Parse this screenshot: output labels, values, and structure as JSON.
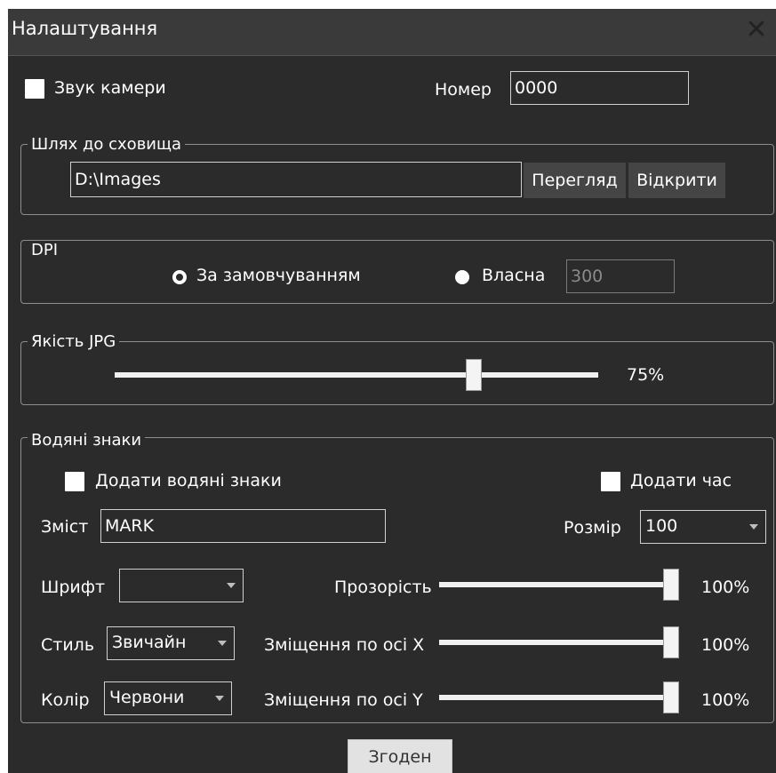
{
  "window": {
    "title": "Налаштування",
    "close_glyph": "✕"
  },
  "camera": {
    "sound_label": "Звук камери",
    "sound_checked": false,
    "number_label": "Номер",
    "number_value": "0000"
  },
  "storage": {
    "legend": "Шлях до сховища",
    "path_value": "D:\\Images",
    "browse_label": "Перегляд",
    "open_label": "Відкрити"
  },
  "dpi": {
    "legend": "DPI",
    "default_label": "За замовчуванням",
    "custom_label": "Власна",
    "custom_value": "300",
    "selected": "default"
  },
  "jpg": {
    "legend": "Якість JPG",
    "quality_label": "75%",
    "quality": 0.75
  },
  "watermark": {
    "legend": "Водяні знаки",
    "add_label": "Додати водяні знаки",
    "add_checked": false,
    "add_time_label": "Додати час",
    "add_time_checked": false,
    "content_label": "Зміст",
    "content_value": "MARK",
    "size_label": "Розмір",
    "size_value": "100",
    "font_label": "Шрифт",
    "font_value": "",
    "style_label": "Стиль",
    "style_value": "Звичайн",
    "color_label": "Колір",
    "color_value": "Червони",
    "opacity_label": "Прозорість",
    "opacity_value": "100%",
    "opacity": 1.0,
    "offset_x_label": "Зміщення по осі X",
    "offset_x_value": "100%",
    "offset_x": 1.0,
    "offset_y_label": "Зміщення по осі Y",
    "offset_y_value": "100%",
    "offset_y": 1.0
  },
  "ok_label": "Згоден",
  "colors": {
    "background": "#2b2b2b",
    "titlebar": "#3a3a3a",
    "button": "#454545",
    "text": "#ffffff"
  }
}
